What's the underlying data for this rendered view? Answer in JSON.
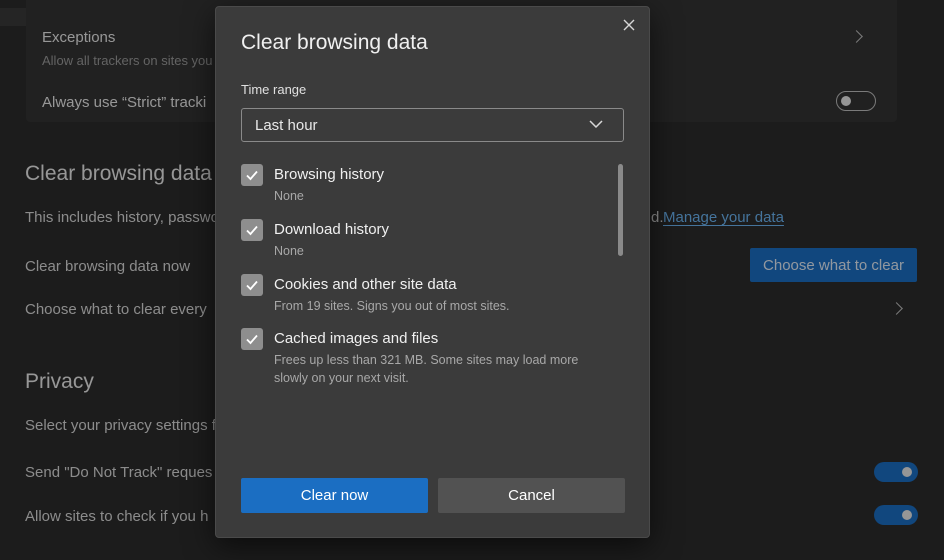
{
  "background": {
    "tracking": {
      "exceptions_title": "Exceptions",
      "exceptions_sub": "Allow all trackers on sites you",
      "strict_label": "Always use “Strict” tracki"
    },
    "clear_section": {
      "title": "Clear browsing data",
      "description": "This includes history, passwo",
      "description_tail": "d.",
      "manage_link": "Manage your data",
      "clear_now_label": "Clear browsing data now",
      "choose_button": "Choose what to clear",
      "choose_every_label": "Choose what to clear every"
    },
    "privacy_section": {
      "title": "Privacy",
      "description": "Select your privacy settings f",
      "dnt_label": "Send \"Do Not Track\" reques",
      "allow_label": "Allow sites to check if you h"
    }
  },
  "dialog": {
    "title": "Clear browsing data",
    "time_range_label": "Time range",
    "time_range_value": "Last hour",
    "items": [
      {
        "label": "Browsing history",
        "description": "None",
        "checked": true
      },
      {
        "label": "Download history",
        "description": "None",
        "checked": true
      },
      {
        "label": "Cookies and other site data",
        "description": "From 19 sites. Signs you out of most sites.",
        "checked": true
      },
      {
        "label": "Cached images and files",
        "description": "Frees up less than 321 MB. Some sites may load more slowly on your next visit.",
        "checked": true
      }
    ],
    "clear_button": "Clear now",
    "cancel_button": "Cancel"
  },
  "colors": {
    "accent": "#1b6ec2",
    "dialog_bg": "#3b3b3b",
    "page_bg": "#2b2b2b",
    "link": "#6bb3f0"
  },
  "icons": {
    "close": "close-icon",
    "dropdown": "chevron-down-icon",
    "check": "checkmark-icon",
    "row_arrow": "chevron-right-icon"
  }
}
